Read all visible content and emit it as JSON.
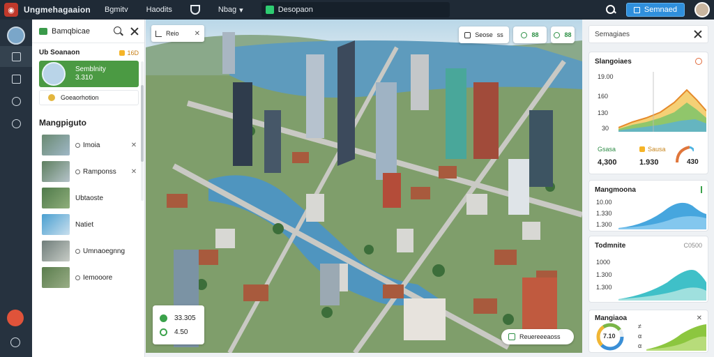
{
  "topbar": {
    "app_title": "Ungmehagaaion",
    "menu": [
      "Bgmitv",
      "Haodits",
      "Nbag"
    ],
    "map_label": "Desopaon",
    "primary_button": "Semnaed"
  },
  "left_panel": {
    "header": "Bamqbicae",
    "section": "Ub Soanaon",
    "section_badge": "16D",
    "profile": {
      "name": "Semblnity",
      "value": "3.310"
    },
    "sub_card": "Goeaorhotion",
    "layers_title": "Mangpiguto",
    "layers": [
      {
        "label": "Imoia",
        "action": "✕"
      },
      {
        "label": "Ramponss",
        "action": "✕"
      },
      {
        "label": "Ubtaoste",
        "action": ""
      },
      {
        "label": "Natiet",
        "action": ""
      },
      {
        "label": "Umnaoegnng",
        "action": ""
      },
      {
        "label": "Iemooore",
        "action": ""
      }
    ]
  },
  "map": {
    "tab_label": "Reio",
    "controls": [
      {
        "label": "Seose",
        "value": "ss"
      },
      {
        "label": "",
        "value": "88"
      },
      {
        "label": "",
        "value": "88"
      }
    ],
    "stats": [
      "33.305",
      "4.50"
    ],
    "pill": "Reuereeeaoss"
  },
  "right_panel": {
    "header": "Semagiaes",
    "card1": {
      "title": "Slangoiaes",
      "y_labels": [
        "19.00",
        "160",
        "130",
        "30"
      ],
      "footer": [
        {
          "label": "Gsasa",
          "value": "4,300"
        },
        {
          "label": "Sausa",
          "value": "1.930"
        },
        {
          "label": "",
          "value": "430"
        }
      ]
    },
    "card2": {
      "title": "Mangmoona",
      "labels": [
        "10.00",
        "1.330",
        "1.300"
      ]
    },
    "card3": {
      "title": "Todmnite",
      "badge": "C0500",
      "labels": [
        "1000",
        "1.300",
        "1.300"
      ]
    },
    "card4": {
      "title": "Mangiaoa",
      "donut_value": "7.10",
      "labels": [
        "≠",
        "α",
        "α"
      ]
    }
  }
}
